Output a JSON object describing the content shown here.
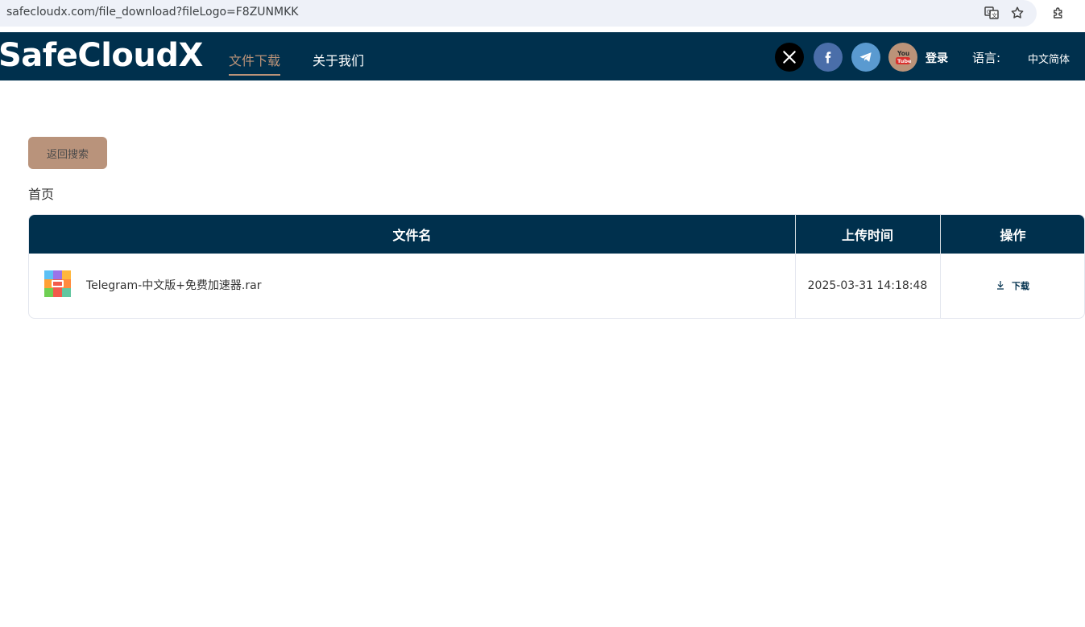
{
  "browser": {
    "url": "safecloudx.com/file_download?fileLogo=F8ZUNMKK",
    "icons": [
      "translate-icon",
      "bookmark-star-icon",
      "extensions-icon"
    ]
  },
  "header": {
    "logo": "SafeCloudX",
    "nav": [
      {
        "label": "文件下载",
        "active": true
      },
      {
        "label": "关于我们",
        "active": false
      }
    ],
    "social": [
      "x-icon",
      "facebook-icon",
      "telegram-icon",
      "youtube-icon"
    ],
    "login_label": "登录",
    "language_label": "语言:",
    "language_value": "中文简体",
    "colors": {
      "header_bg": "#00304d",
      "accent": "#bb9379"
    }
  },
  "main": {
    "back_button": "返回搜索",
    "breadcrumb": "首页",
    "table": {
      "columns": [
        "文件名",
        "上传时间",
        "操作"
      ],
      "rows": [
        {
          "file_name": "Telegram-中文版+免费加速器.rar",
          "upload_time": "2025-03-31 14:18:48",
          "action": "下载"
        }
      ]
    }
  }
}
